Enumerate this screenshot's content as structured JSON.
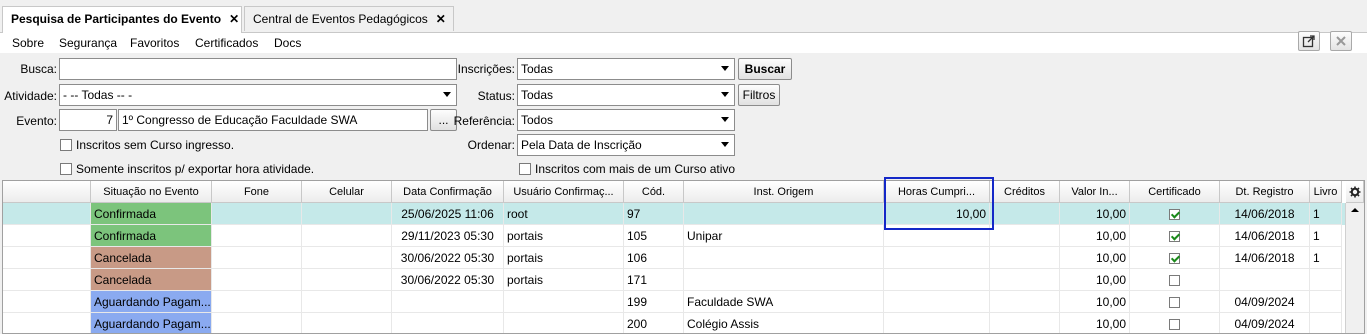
{
  "tabs": [
    {
      "label": "Pesquisa de Participantes do Evento",
      "close": "✕"
    },
    {
      "label": "Central de Eventos Pedagógicos",
      "close": "✕"
    }
  ],
  "menu": [
    "Sobre",
    "Segurança",
    "Favoritos",
    "Certificados",
    "Docs"
  ],
  "form": {
    "busca_label": "Busca:",
    "busca_value": "",
    "atividade_label": "Atividade:",
    "atividade_value": "- -- Todas -- -",
    "evento_label": "Evento:",
    "evento_code": "7",
    "evento_name": "1º Congresso de Educação Faculdade SWA",
    "evento_btn": "...",
    "inscricoes_label": "Inscrições:",
    "inscricoes_value": "Todas",
    "buscar_btn": "Buscar",
    "status_label": "Status:",
    "status_value": "Todas",
    "filtros_btn": "Filtros",
    "referencia_label": "Referência:",
    "referencia_value": "Todos",
    "ordenar_label": "Ordenar:",
    "ordenar_value": "Pela Data de Inscrição",
    "chk_sem_curso": "Inscritos sem Curso ingresso.",
    "chk_exportar": "Somente inscritos p/ exportar hora atividade.",
    "chk_mais_curso": "Inscritos com mais de um Curso ativo"
  },
  "grid": {
    "headers": [
      "",
      "Situação no Evento",
      "Fone",
      "Celular",
      "Data Confirmação",
      "Usuário Confirmaç...",
      "Cód.",
      "Inst. Origem",
      "Horas Cumpri...",
      "Créditos",
      "Valor In...",
      "Certificado",
      "Dt. Registro",
      "Livro"
    ],
    "rows": [
      {
        "situacao": "Confirmada",
        "color": "#7cc47c",
        "fone": "",
        "celular": "",
        "data": "25/06/2025 11:06",
        "usuario": "root",
        "cod": "97",
        "inst": "",
        "horas": "10,00",
        "creditos": "",
        "valor": "10,00",
        "cert": true,
        "dt": "14/06/2018",
        "livro": "1"
      },
      {
        "situacao": "Confirmada",
        "color": "#7cc47c",
        "fone": "",
        "celular": "",
        "data": "29/11/2023 05:30",
        "usuario": "portais",
        "cod": "105",
        "inst": "Unipar",
        "horas": "",
        "creditos": "",
        "valor": "10,00",
        "cert": true,
        "dt": "14/06/2018",
        "livro": "1"
      },
      {
        "situacao": "Cancelada",
        "color": "#c89a86",
        "fone": "",
        "celular": "",
        "data": "30/06/2022 05:30",
        "usuario": "portais",
        "cod": "106",
        "inst": "",
        "horas": "",
        "creditos": "",
        "valor": "10,00",
        "cert": true,
        "dt": "14/06/2018",
        "livro": "1"
      },
      {
        "situacao": "Cancelada",
        "color": "#c89a86",
        "fone": "",
        "celular": "",
        "data": "30/06/2022 05:30",
        "usuario": "portais",
        "cod": "171",
        "inst": "",
        "horas": "",
        "creditos": "",
        "valor": "10,00",
        "cert": false,
        "dt": "",
        "livro": ""
      },
      {
        "situacao": "Aguardando Pagam...",
        "color": "#8aaaf0",
        "fone": "",
        "celular": "",
        "data": "",
        "usuario": "",
        "cod": "199",
        "inst": "Faculdade SWA",
        "horas": "",
        "creditos": "",
        "valor": "10,00",
        "cert": false,
        "dt": "04/09/2024",
        "livro": ""
      },
      {
        "situacao": "Aguardando Pagam...",
        "color": "#8aaaf0",
        "fone": "",
        "celular": "",
        "data": "",
        "usuario": "",
        "cod": "200",
        "inst": "Colégio Assis",
        "horas": "",
        "creditos": "",
        "valor": "10,00",
        "cert": false,
        "dt": "04/09/2024",
        "livro": ""
      }
    ]
  },
  "icons": {
    "popout": "popout-icon",
    "close_panel": "close-panel-icon",
    "settings": "gear-icon"
  }
}
